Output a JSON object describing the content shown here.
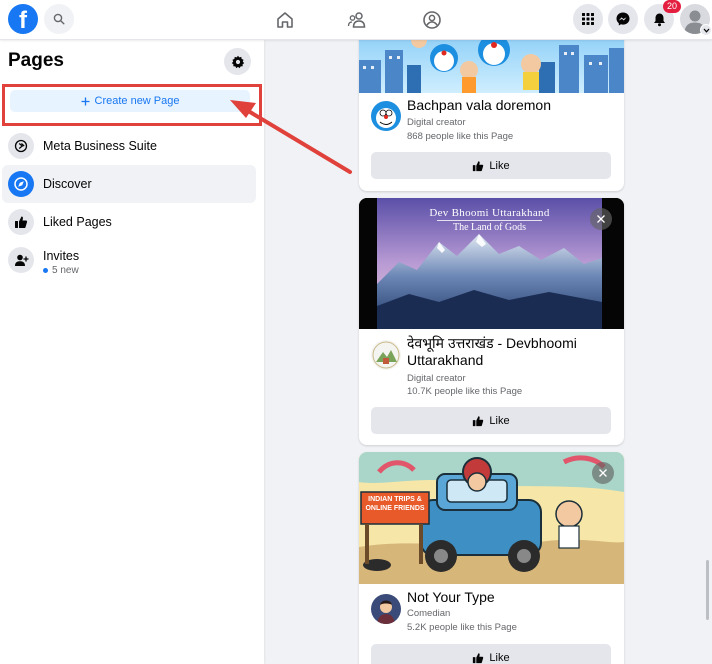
{
  "topbar": {
    "logo_letter": "f",
    "notification_count": "20"
  },
  "sidebar": {
    "title": "Pages",
    "create_button_label": "Create new Page",
    "items": [
      {
        "label": "Meta Business Suite",
        "icon": "meta-business-suite-icon"
      },
      {
        "label": "Discover",
        "icon": "compass-icon"
      },
      {
        "label": "Liked Pages",
        "icon": "thumbs-up-icon"
      },
      {
        "label": "Invites",
        "icon": "person-add-icon"
      }
    ],
    "invites_sub": "5 new"
  },
  "cards": [
    {
      "name": "Bachpan vala doremon",
      "category": "Digital creator",
      "likes": "868 people like this Page",
      "like_label": "Like"
    },
    {
      "banner_title": "Dev Bhoomi Uttarakhand",
      "banner_subtitle": "The Land of Gods",
      "name": "देवभूमि उत्तराखंड - Devbhoomi Uttarakhand",
      "category": "Digital creator",
      "likes": "10.7K people like this Page",
      "like_label": "Like"
    },
    {
      "banner_sign": "INDIAN TRIPS & ONLINE FRIENDS",
      "name": "Not Your Type",
      "category": "Comedian",
      "likes": "5.2K people like this Page",
      "like_label": "Like"
    }
  ],
  "colors": {
    "brand": "#1877f2",
    "highlight": "#e0413b",
    "badge": "#e41e3f"
  }
}
